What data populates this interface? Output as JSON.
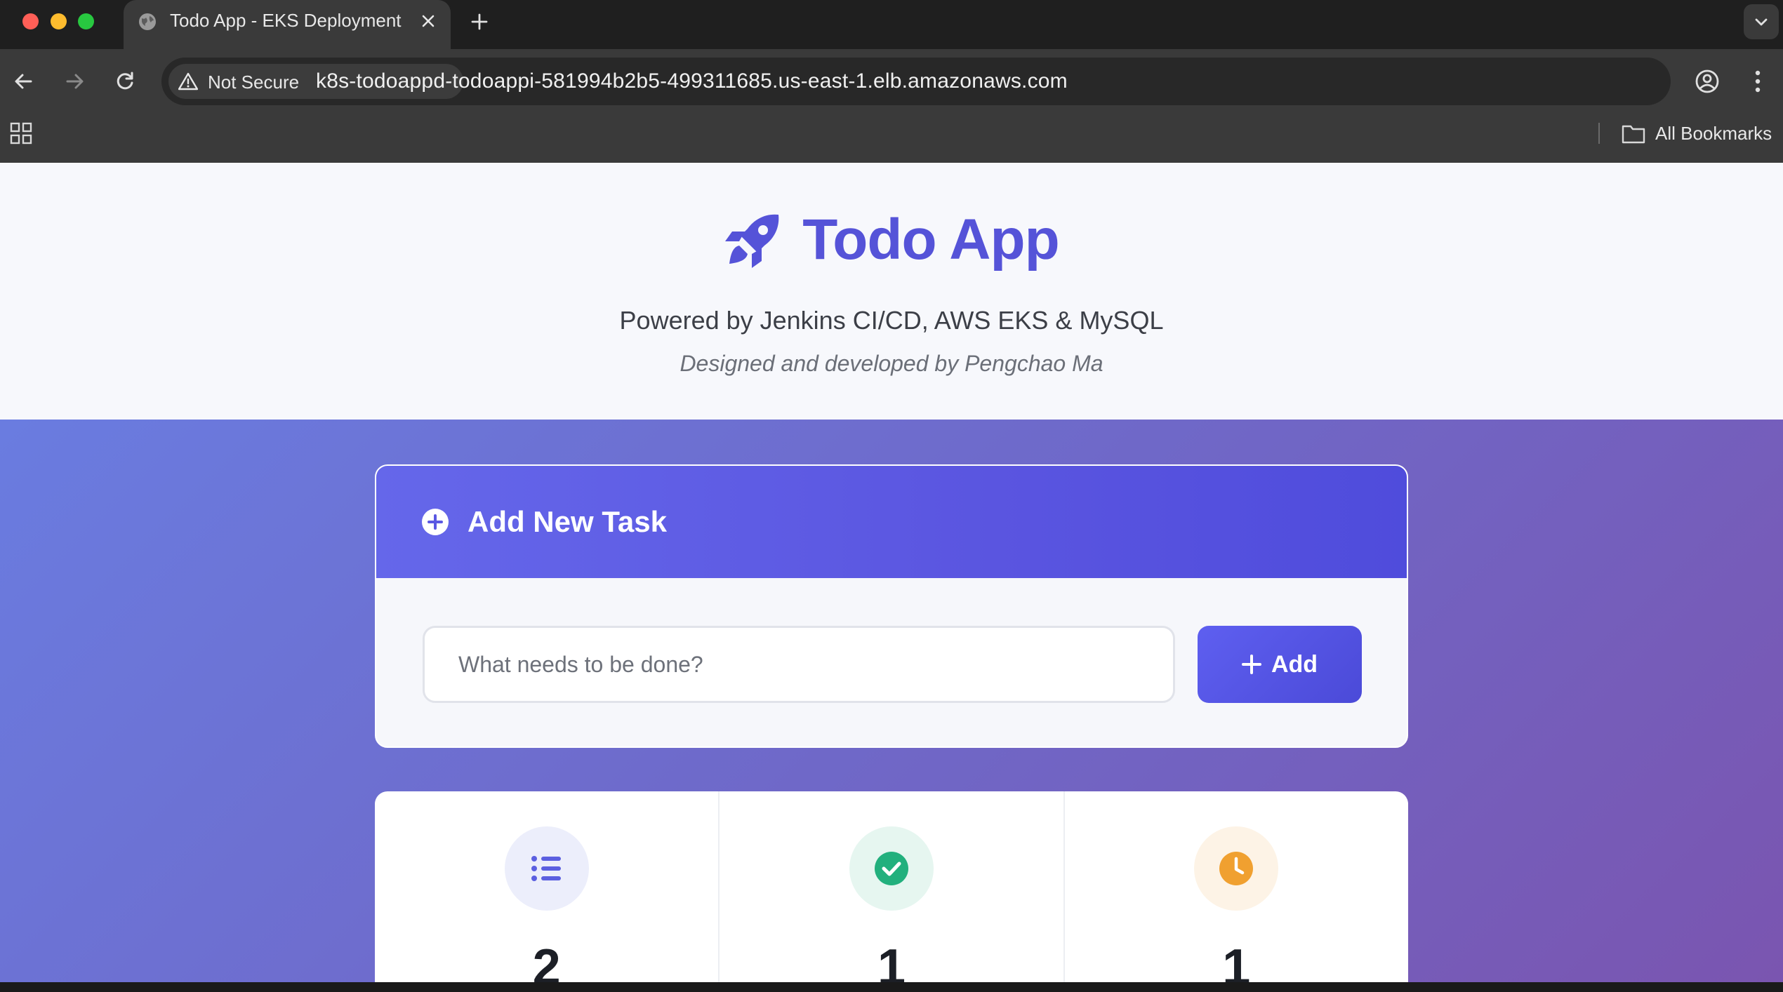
{
  "browser": {
    "tab_title": "Todo App - EKS Deployment",
    "security_label": "Not Secure",
    "url": "k8s-todoappd-todoappi-581994b2b5-499311685.us-east-1.elb.amazonaws.com",
    "bookmarks_label": "All Bookmarks"
  },
  "hero": {
    "title": "Todo App",
    "subtitle": "Powered by Jenkins CI/CD, AWS EKS & MySQL",
    "credit": "Designed and developed by Pengchao Ma",
    "accent_color": "#5553d8"
  },
  "add_task": {
    "heading": "Add New Task",
    "input_placeholder": "What needs to be done?",
    "input_value": "",
    "button_label": "Add"
  },
  "stats": [
    {
      "icon": "list-icon",
      "value": "2",
      "icon_color": "#5b5fe0",
      "bg_color": "#eceefb"
    },
    {
      "icon": "check-circle-icon",
      "value": "1",
      "icon_color": "#22b07d",
      "bg_color": "#e6f6f0"
    },
    {
      "icon": "clock-icon",
      "value": "1",
      "icon_color": "#f0a030",
      "bg_color": "#fdf3e6"
    }
  ]
}
